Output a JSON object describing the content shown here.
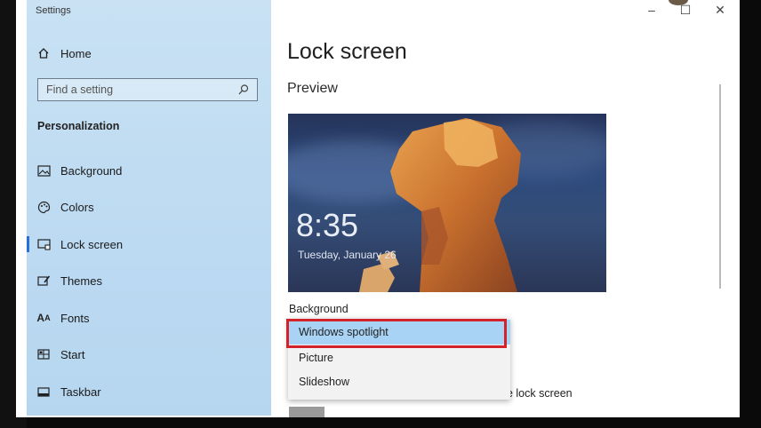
{
  "window": {
    "title": "Settings",
    "controls": [
      "–",
      "☐",
      "✕"
    ]
  },
  "sidebar": {
    "home_label": "Home",
    "search_placeholder": "Find a setting",
    "section_title": "Personalization",
    "items": [
      {
        "label": "Background",
        "icon": "image-icon"
      },
      {
        "label": "Colors",
        "icon": "palette-icon"
      },
      {
        "label": "Lock screen",
        "icon": "lock-screen-icon",
        "active": true
      },
      {
        "label": "Themes",
        "icon": "themes-icon"
      },
      {
        "label": "Fonts",
        "icon": "fonts-icon"
      },
      {
        "label": "Start",
        "icon": "start-icon"
      },
      {
        "label": "Taskbar",
        "icon": "taskbar-icon"
      }
    ]
  },
  "main": {
    "title": "Lock screen",
    "preview_label": "Preview",
    "preview": {
      "time": "8:35",
      "date": "Tuesday, January 26"
    },
    "background_label": "Background",
    "dropdown": {
      "options": [
        "Windows spotlight",
        "Picture",
        "Slideshow"
      ],
      "selected": "Windows spotlight"
    },
    "partial_text": "he lock screen"
  },
  "colors": {
    "accent": "#2a6fd6",
    "selection": "#a9d3f5",
    "highlight": "#d3232a"
  }
}
